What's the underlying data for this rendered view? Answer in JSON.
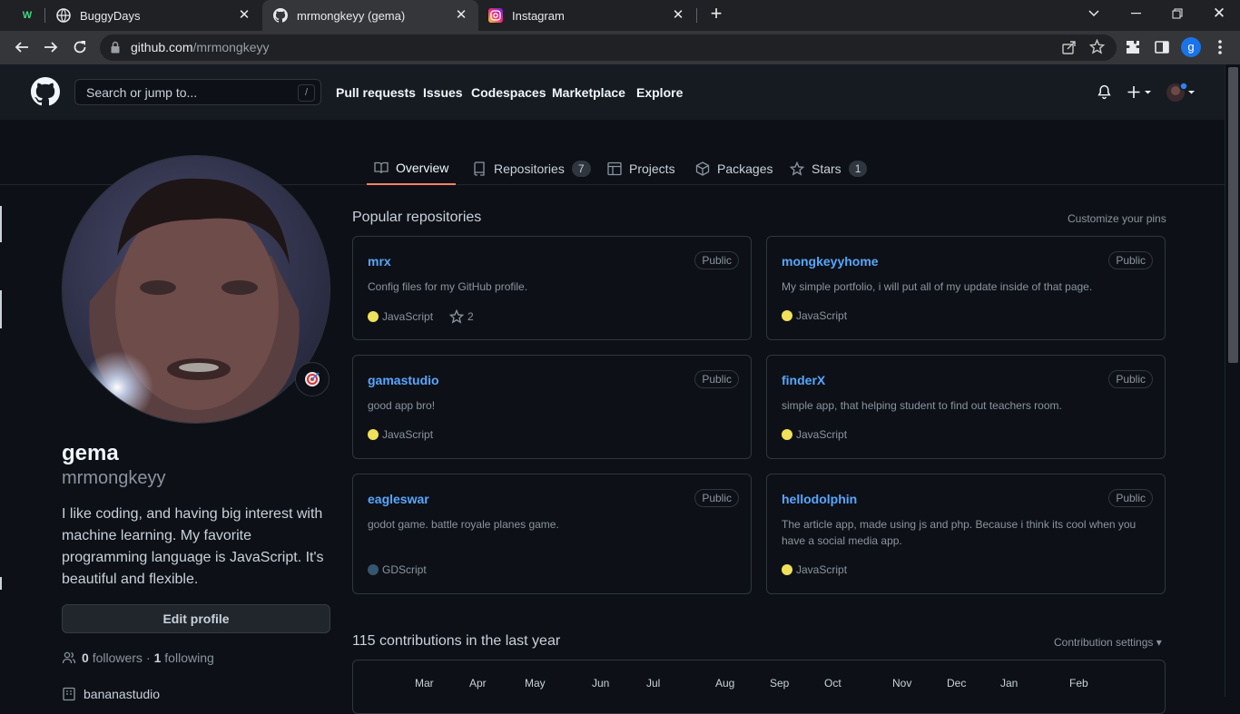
{
  "browser": {
    "tabs": [
      {
        "title": ""
      },
      {
        "title": "BuggyDays"
      },
      {
        "title": "mrmongkeyy (gema)"
      },
      {
        "title": "Instagram"
      }
    ],
    "url_host": "github.com",
    "url_path": "/mrmongkeyy",
    "profile_initial": "g"
  },
  "header": {
    "search_placeholder": "Search or jump to...",
    "search_shortcut": "/",
    "nav": [
      "Pull requests",
      "Issues",
      "Codespaces",
      "Marketplace",
      "Explore"
    ]
  },
  "profile_tabs": [
    {
      "label": "Overview"
    },
    {
      "label": "Repositories",
      "count": "7"
    },
    {
      "label": "Projects"
    },
    {
      "label": "Packages"
    },
    {
      "label": "Stars",
      "count": "1"
    }
  ],
  "profile": {
    "name": "gema",
    "login": "mrmongkeyy",
    "bio": "I like coding, and having big interest with machine learning. My favorite programming language is JavaScript. It's beautiful and flexible.",
    "edit_label": "Edit profile",
    "followers_count": "0",
    "followers_label": "followers",
    "following_count": "1",
    "following_label": "following",
    "organization": "bananastudio"
  },
  "popular": {
    "title": "Popular repositories",
    "customize": "Customize your pins",
    "repos": [
      {
        "name": "mrx",
        "visibility": "Public",
        "description": "Config files for my GitHub profile.",
        "language": "JavaScript",
        "lang_color": "#f1e05a",
        "stars": "2"
      },
      {
        "name": "mongkeyyhome",
        "visibility": "Public",
        "description": "My simple portfolio, i will put all of my update inside of that page.",
        "language": "JavaScript",
        "lang_color": "#f1e05a"
      },
      {
        "name": "gamastudio",
        "visibility": "Public",
        "description": "good app bro!",
        "language": "JavaScript",
        "lang_color": "#f1e05a"
      },
      {
        "name": "finderX",
        "visibility": "Public",
        "description": "simple app, that helping student to find out teachers room.",
        "language": "JavaScript",
        "lang_color": "#f1e05a"
      },
      {
        "name": "eagleswar",
        "visibility": "Public",
        "description": "godot game. battle royale planes game.",
        "language": "GDScript",
        "lang_color": "#355570"
      },
      {
        "name": "hellodolphin",
        "visibility": "Public",
        "description": "The article app, made using js and php. Because i think its cool when you have a social media app.",
        "language": "JavaScript",
        "lang_color": "#f1e05a"
      }
    ]
  },
  "contributions": {
    "title": "115 contributions in the last year",
    "settings": "Contribution settings",
    "months": [
      "Mar",
      "Apr",
      "May",
      "Jun",
      "Jul",
      "Aug",
      "Sep",
      "Oct",
      "Nov",
      "Dec",
      "Jan",
      "Feb"
    ]
  }
}
